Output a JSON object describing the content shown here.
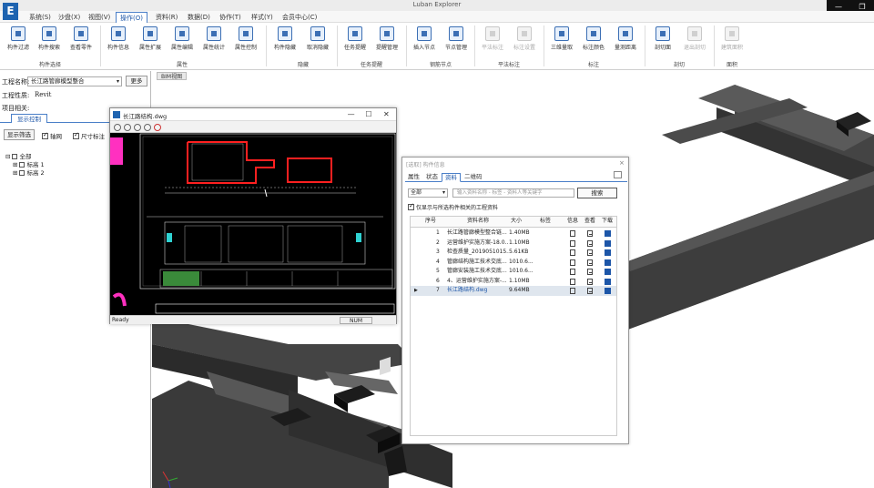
{
  "app": {
    "logo": "E",
    "title": "Luban Explorer"
  },
  "window_controls": [
    "—",
    "❐"
  ],
  "menu": [
    "系统(S)",
    "沙盘(X)",
    "视图(V)",
    "操作(O)",
    "资料(R)",
    "数据(D)",
    "协作(T)",
    "样式(Y)",
    "会员中心(C)"
  ],
  "ribbon": {
    "buttons": [
      "构件过滤",
      "构件搜索",
      "查看零件",
      "构件信息",
      "属性扩展",
      "属性编辑",
      "属性统计",
      "属性控制",
      "构件隐藏",
      "取消隐藏",
      "任务提醒",
      "提醒管理",
      "插入节点",
      "节点管理",
      "平法标注",
      "标注设置",
      "三维量取",
      "标注颜色",
      "量测距离",
      "剖切面",
      "退出剖切",
      "建筑面积"
    ],
    "groups": [
      "构件选择",
      "属性",
      "隐藏",
      "任务提醒",
      "钢筋节点",
      "平法标注",
      "标注",
      "剖切",
      "面积"
    ]
  },
  "left_panel": {
    "project_label": "工程名称:",
    "project_value": "长江路管廊模型整合",
    "more_label": "更多",
    "nature_label": "工程性质:",
    "nature_value": "Revit",
    "related_label": "项目相关:",
    "display_tab": "显示控制",
    "filter_label": "显示筛选",
    "axis_label": "轴网",
    "dimension_label": "尺寸标注",
    "tree": {
      "root": "全部",
      "children": [
        "标高 1",
        "标高 2"
      ]
    }
  },
  "viewport": {
    "tab": "BIM视图"
  },
  "dwg_window": {
    "title": "长江路结构.dwg",
    "controls": [
      "—",
      "☐",
      "✕"
    ],
    "status": "Ready",
    "num": "NUM"
  },
  "data_panel": {
    "title": "[选取] 构件信息",
    "close": "×",
    "tabs": [
      "属性",
      "状态",
      "资料",
      "二维码"
    ],
    "category": "全部",
    "search_placeholder": "输入资料名称 - 标签 - 资料人等关键字",
    "search_button": "搜索",
    "only_related": "仅显示与所选构件相关的工程资料",
    "columns": [
      "序号",
      "资料名称",
      "大小",
      "标签",
      "信息",
      "查看",
      "下载"
    ],
    "rows": [
      {
        "no": "1",
        "name": "长江路管廊模型整合链...",
        "size": "1.40MB"
      },
      {
        "no": "2",
        "name": "运营维护实施方案-18.0...",
        "size": "1.10MB"
      },
      {
        "no": "3",
        "name": "检查质量_2019051015...",
        "size": "5.61KB"
      },
      {
        "no": "4",
        "name": "管廊结构施工技术交底...",
        "size": "1010.6..."
      },
      {
        "no": "5",
        "name": "管廊安装施工技术交底...",
        "size": "1010.6..."
      },
      {
        "no": "6",
        "name": "4、运营维护实施方案-...",
        "size": "1.10MB"
      },
      {
        "no": "7",
        "name": "长江路结构.dwg",
        "size": "9.64MB"
      }
    ],
    "selected_row": 6
  },
  "colors": {
    "accent": "#1d56a8",
    "cad_red": "#ff2020",
    "cad_bg": "#000000",
    "beam": "#3a3a3a"
  }
}
